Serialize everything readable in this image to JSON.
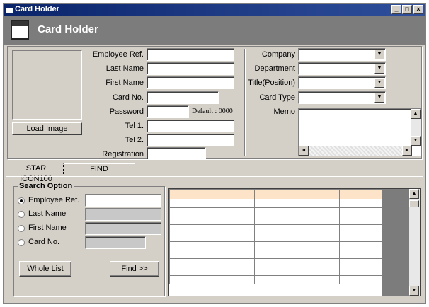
{
  "window": {
    "title": "Card Holder"
  },
  "header": {
    "title": "Card Holder"
  },
  "left_form": {
    "employee_ref_label": "Employee Ref.",
    "last_name_label": "Last Name",
    "first_name_label": "First Name",
    "card_no_label": "Card No.",
    "password_label": "Password",
    "password_default": "Default : 0000",
    "tel1_label": "Tel 1.",
    "tel2_label": "Tel 2.",
    "registration_label": "Registration",
    "load_image_label": "Load Image"
  },
  "right_form": {
    "company_label": "Company",
    "department_label": "Department",
    "title_label": "Title(Position)",
    "card_type_label": "Card Type",
    "memo_label": "Memo"
  },
  "tabs": [
    {
      "label": "STAR ICON100"
    },
    {
      "label": "FIND"
    }
  ],
  "search": {
    "group_label": "Search Option",
    "options": [
      {
        "label": "Employee Ref.",
        "selected": true
      },
      {
        "label": "Last Name",
        "selected": false
      },
      {
        "label": "First Name",
        "selected": false
      },
      {
        "label": "Card No.",
        "selected": false
      }
    ],
    "whole_list_label": "Whole List",
    "find_label": "Find >>"
  },
  "results_grid": {
    "header_color": "#fde4c8",
    "columns": 5,
    "rows": 11
  }
}
